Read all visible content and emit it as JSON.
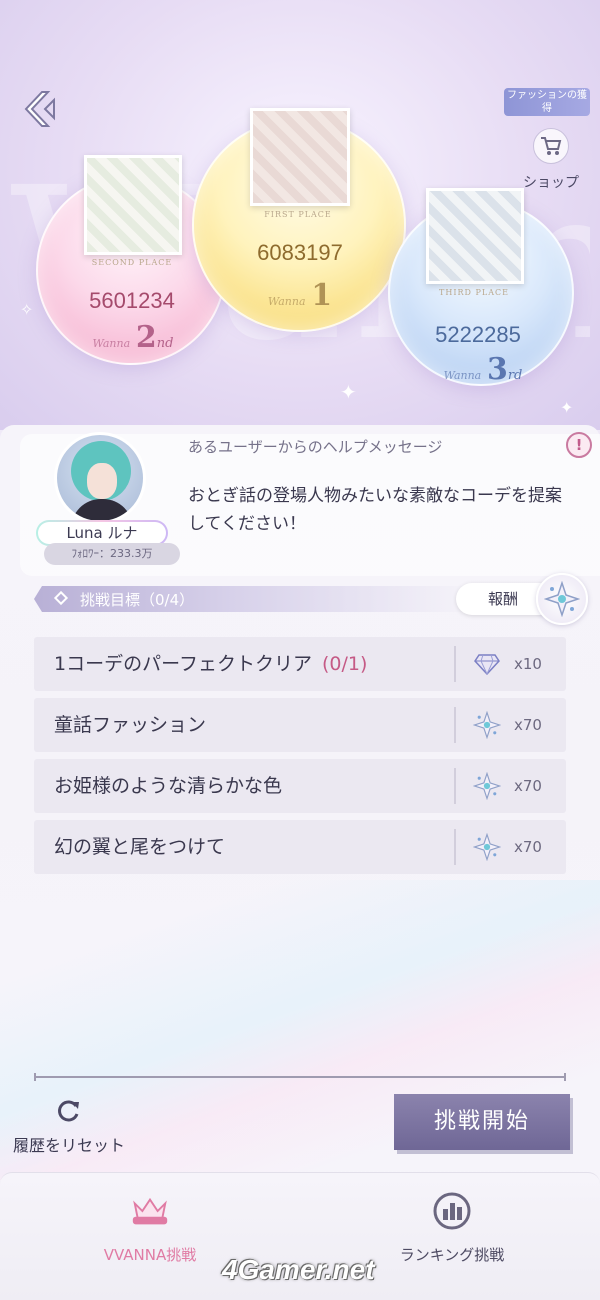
{
  "header": {
    "fashion_guide_label": "ファッションの獲得",
    "shop_label": "ショップ",
    "back_icon": "chevron-left-icon",
    "shop_icon": "cart-icon"
  },
  "podium": {
    "first": {
      "caption": "FIRST PLACE",
      "score": "6083197",
      "rank": "1"
    },
    "second": {
      "caption": "SECOND PLACE",
      "score": "5601234",
      "rank": "2",
      "suffix": "nd"
    },
    "third": {
      "caption": "THIRD PLACE",
      "score": "5222285",
      "rank": "3",
      "suffix": "rd"
    },
    "sign_text": "Wanna"
  },
  "help": {
    "title": "あるユーザーからのヘルプメッセージ",
    "message": "おとぎ話の登場人物みたいな素敵なコーデを提案してください！",
    "info_icon_text": "!",
    "user_name": "Luna ルナ",
    "followers": "ﾌｫﾛﾜｰ：233.3万"
  },
  "goals": {
    "title": "挑戦目標（0/4）",
    "reward_label": "報酬",
    "tasks": [
      {
        "label": "1コーデのパーフェクトクリア",
        "progress": "(0/1)",
        "icon": "diamond-icon",
        "count": "x10"
      },
      {
        "label": "童話ファッション",
        "progress": "",
        "icon": "star-gem-icon",
        "count": "x70"
      },
      {
        "label": "お姫様のような清らかな色",
        "progress": "",
        "icon": "star-gem-icon",
        "count": "x70"
      },
      {
        "label": "幻の翼と尾をつけて",
        "progress": "",
        "icon": "star-gem-icon",
        "count": "x70"
      }
    ]
  },
  "actions": {
    "reset_label": "履歴をリセット",
    "start_label": "挑戦開始"
  },
  "tabs": {
    "wanna": "VVANNA挑戦",
    "ranking": "ランキング挑戦"
  },
  "watermark": "4Gamer.net",
  "colors": {
    "accent_pink": "#e07ba4",
    "progress_pink": "#c55a86",
    "start_button": "#766e9c"
  }
}
